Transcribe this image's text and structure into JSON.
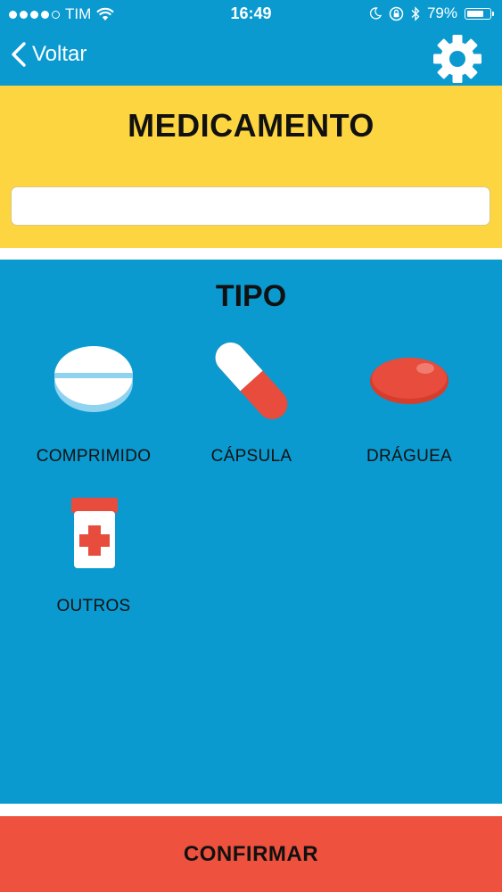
{
  "status_bar": {
    "carrier": "TIM",
    "time": "16:49",
    "battery_percent": "79%",
    "battery_level": 0.79,
    "icons": [
      "signal-dots-icon",
      "wifi-icon",
      "moon-icon",
      "rotation-lock-icon",
      "bluetooth-icon",
      "battery-icon"
    ]
  },
  "nav": {
    "back_label": "Voltar",
    "back_icon": "chevron-left-icon",
    "settings_icon": "gear-icon"
  },
  "medicamento": {
    "title": "MEDICAMENTO",
    "input_value": ""
  },
  "tipo": {
    "title": "TIPO",
    "options": [
      {
        "label": "COMPRIMIDO",
        "icon": "tablet-icon"
      },
      {
        "label": "CÁPSULA",
        "icon": "capsule-icon"
      },
      {
        "label": "DRÁGUEA",
        "icon": "dragee-icon"
      },
      {
        "label": "OUTROS",
        "icon": "medicine-bottle-icon"
      }
    ]
  },
  "actions": {
    "confirm_label": "CONFIRMAR"
  },
  "colors": {
    "blue": "#0a9ad0",
    "yellow": "#fdd540",
    "red": "#ee513d",
    "pill_red": "#e74c3c",
    "white": "#ffffff"
  }
}
